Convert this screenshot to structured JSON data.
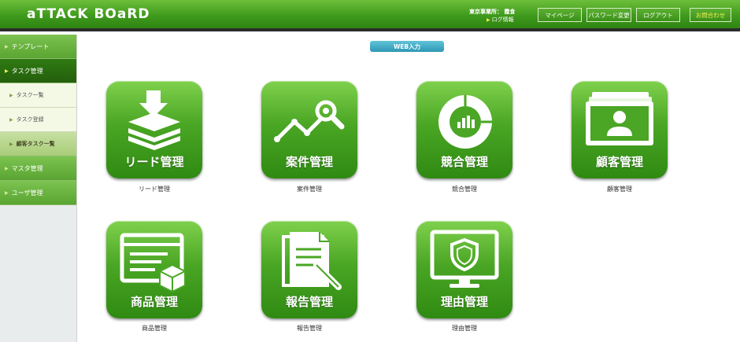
{
  "header": {
    "logo": "aTTACK BOaRD",
    "office": "東京事業所： 霞食",
    "log_link": "ログ情報",
    "buttons": [
      {
        "label": "マイページ"
      },
      {
        "label": "パスワード変更"
      },
      {
        "label": "ログアウト"
      },
      {
        "label": "お問合わせ"
      }
    ]
  },
  "sidebar": {
    "items": [
      {
        "label": "テンプレート"
      },
      {
        "label": "タスク管理"
      },
      {
        "label": "タスク一覧"
      },
      {
        "label": "タスク登録"
      },
      {
        "label": "顧客タスク一覧"
      },
      {
        "label": "マスタ管理"
      },
      {
        "label": "ユーザ管理"
      }
    ]
  },
  "main": {
    "web_input": "WEB入力",
    "tiles": [
      {
        "label": "リード管理",
        "caption": "リード管理",
        "icon": "lead-stack-icon"
      },
      {
        "label": "案件管理",
        "caption": "案件管理",
        "icon": "trend-search-icon"
      },
      {
        "label": "競合管理",
        "caption": "競合管理",
        "icon": "donut-chart-icon"
      },
      {
        "label": "顧客管理",
        "caption": "顧客管理",
        "icon": "customer-cards-icon"
      },
      {
        "label": "商品管理",
        "caption": "商品管理",
        "icon": "product-box-icon"
      },
      {
        "label": "報告管理",
        "caption": "報告管理",
        "icon": "report-pen-icon"
      },
      {
        "label": "理由管理",
        "caption": "理由管理",
        "icon": "monitor-shield-icon"
      }
    ]
  }
}
